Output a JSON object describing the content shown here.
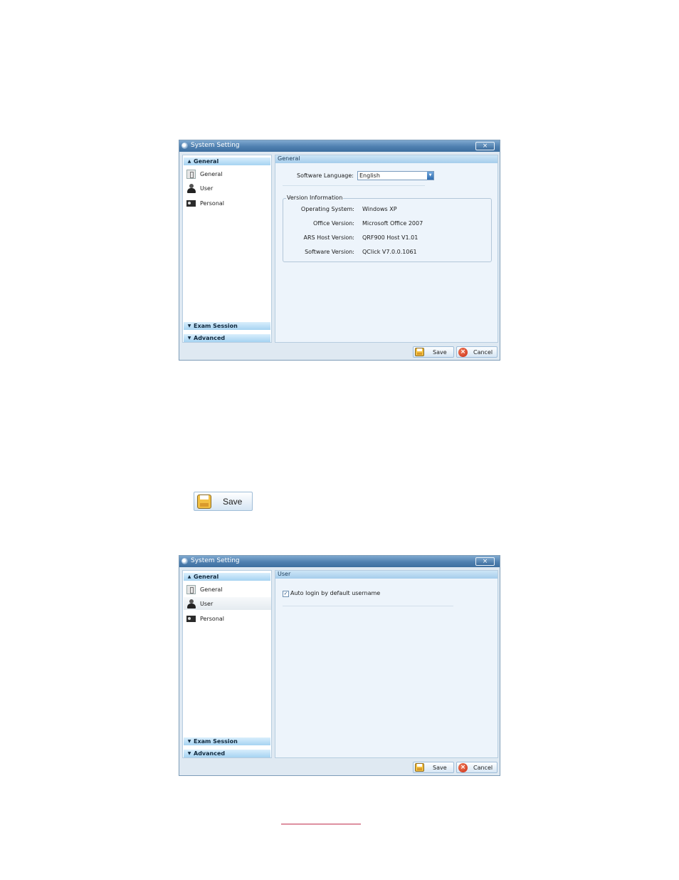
{
  "window1": {
    "title": "System Setting",
    "close_label": "×",
    "sidebar": {
      "general_header": "General",
      "items": [
        "General",
        "User",
        "Personal"
      ],
      "exam_session": "Exam Session",
      "advanced": "Advanced"
    },
    "content": {
      "header": "General",
      "software_language_label": "Software Language:",
      "software_language_value": "English",
      "version_group": "Version Information",
      "rows": [
        {
          "label": "Operating System:",
          "value": "Windows XP"
        },
        {
          "label": "Office Version:",
          "value": "Microsoft Office 2007"
        },
        {
          "label": "ARS Host Version:",
          "value": "QRF900 Host V1.01"
        },
        {
          "label": "Software Version:",
          "value": "QClick V7.0.0.1061"
        }
      ]
    },
    "buttons": {
      "save": "Save",
      "cancel": "Cancel"
    }
  },
  "save_button_large": "Save",
  "window2": {
    "title": "System Setting",
    "close_label": "×",
    "sidebar": {
      "general_header": "General",
      "items": [
        "General",
        "User",
        "Personal"
      ],
      "selected": "User",
      "exam_session": "Exam Session",
      "advanced": "Advanced"
    },
    "content": {
      "header": "User",
      "auto_login_label": "Auto login by default username",
      "auto_login_checked": true,
      "check_mark": "✓"
    },
    "buttons": {
      "save": "Save",
      "cancel": "Cancel"
    }
  }
}
